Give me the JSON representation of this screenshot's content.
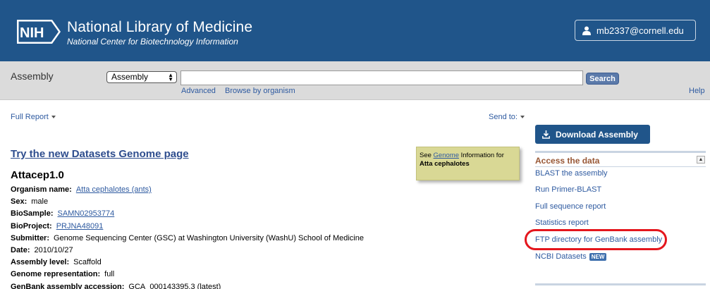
{
  "header": {
    "logo_text": "NIH",
    "title": "National Library of Medicine",
    "subtitle": "National Center for Biotechnology Information",
    "user": "mb2337@cornell.edu"
  },
  "search": {
    "db_label": "Assembly",
    "db_selected": "Assembly",
    "placeholder": "",
    "button": "Search",
    "advanced": "Advanced",
    "browse": "Browse by organism",
    "help": "Help"
  },
  "content": {
    "full_report": "Full Report",
    "send_to": "Send to:",
    "datasets_link": "Try the new Datasets Genome page",
    "genome_box": {
      "prefix": "See",
      "link": "Genome",
      "suffix": "Information for",
      "organism": "Atta cephalotes"
    },
    "assembly_title": "Attacep1.0",
    "fields": {
      "organism_label": "Organism name:",
      "organism_value": "Atta cephalotes (ants)",
      "sex_label": "Sex:",
      "sex_value": "male",
      "biosample_label": "BioSample:",
      "biosample_value": "SAMN02953774",
      "bioproject_label": "BioProject:",
      "bioproject_value": "PRJNA48091",
      "submitter_label": "Submitter:",
      "submitter_value": "Genome Sequencing Center (GSC) at Washington University (WashU) School of Medicine",
      "date_label": "Date:",
      "date_value": "2010/10/27",
      "level_label": "Assembly level:",
      "level_value": "Scaffold",
      "representation_label": "Genome representation:",
      "representation_value": "full",
      "genbank_label": "GenBank assembly accession:",
      "genbank_value": "GCA_000143395.3 (latest)"
    }
  },
  "sidebar": {
    "download_button": "Download Assembly",
    "access_title": "Access the data",
    "collapse_glyph": "▲",
    "links": [
      "BLAST the assembly",
      "Run Primer-BLAST",
      "Full sequence report",
      "Statistics report",
      "FTP directory for GenBank assembly",
      "NCBI Datasets"
    ],
    "new_badge": "NEW"
  },
  "colors": {
    "header_bg": "#20558a",
    "link": "#2e5aa0",
    "access_title": "#985735",
    "highlight": "#e4161d"
  }
}
